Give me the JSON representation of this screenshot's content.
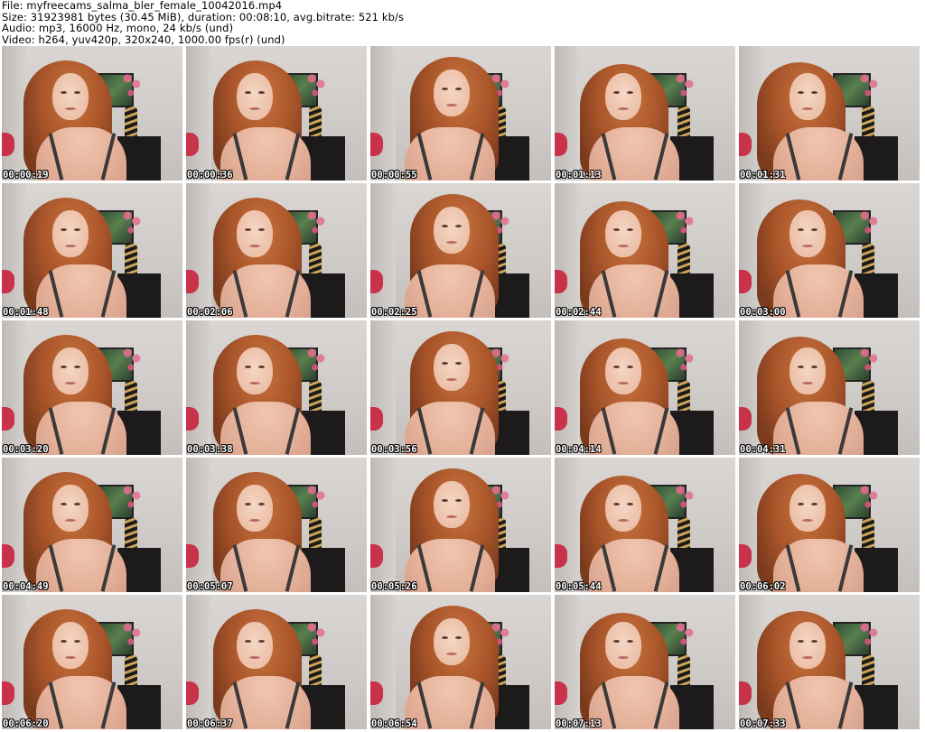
{
  "header": {
    "file_line": "File: myfreecams_salma_bler_female_10042016.mp4",
    "size_line": "Size: 31923981 bytes (30.45 MiB), duration: 00:08:10, avg.bitrate: 521 kb/s",
    "audio_line": "Audio: mp3, 16000 Hz, mono, 24 kb/s (und)",
    "video_line": "Video: h264, yuv420p, 320x240, 1000.00 fps(r) (und)"
  },
  "thumbnails": [
    {
      "timestamp": "00:00:19"
    },
    {
      "timestamp": "00:00:36"
    },
    {
      "timestamp": "00:00:55"
    },
    {
      "timestamp": "00:01:13"
    },
    {
      "timestamp": "00:01:31"
    },
    {
      "timestamp": "00:01:48"
    },
    {
      "timestamp": "00:02:06"
    },
    {
      "timestamp": "00:02:25"
    },
    {
      "timestamp": "00:02:44"
    },
    {
      "timestamp": "00:03:00"
    },
    {
      "timestamp": "00:03:20"
    },
    {
      "timestamp": "00:03:38"
    },
    {
      "timestamp": "00:03:56"
    },
    {
      "timestamp": "00:04:14"
    },
    {
      "timestamp": "00:04:31"
    },
    {
      "timestamp": "00:04:49"
    },
    {
      "timestamp": "00:05:07"
    },
    {
      "timestamp": "00:05:26"
    },
    {
      "timestamp": "00:05:44"
    },
    {
      "timestamp": "00:06:02"
    },
    {
      "timestamp": "00:06:20"
    },
    {
      "timestamp": "00:06:37"
    },
    {
      "timestamp": "00:06:54"
    },
    {
      "timestamp": "00:07:13"
    },
    {
      "timestamp": "00:07:33"
    }
  ]
}
